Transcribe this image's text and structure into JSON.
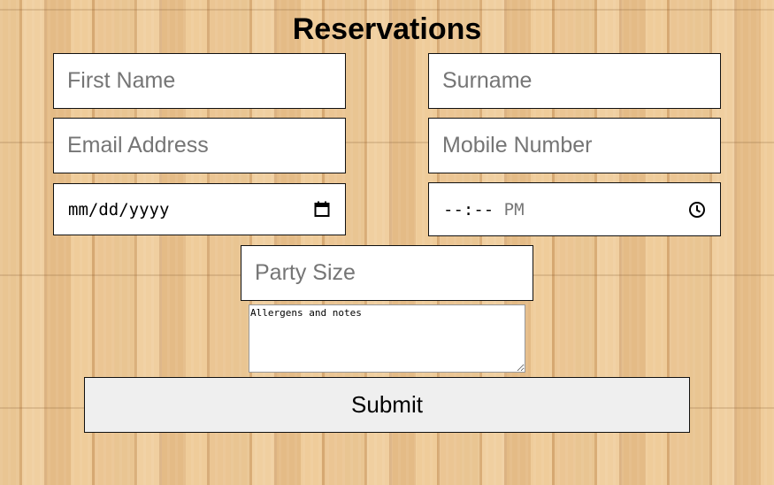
{
  "page": {
    "title": "Reservations"
  },
  "form": {
    "first_name": {
      "placeholder": "First Name",
      "value": ""
    },
    "surname": {
      "placeholder": "Surname",
      "value": ""
    },
    "email": {
      "placeholder": "Email Address",
      "value": ""
    },
    "mobile": {
      "placeholder": "Mobile Number",
      "value": ""
    },
    "date": {
      "display": "mm/dd/yyyy",
      "icon": "calendar-icon"
    },
    "time": {
      "display_hm": "--:--",
      "display_ampm": "PM",
      "icon": "clock-icon"
    },
    "party_size": {
      "placeholder": "Party Size",
      "value": ""
    },
    "notes": {
      "placeholder": "Allergens and notes",
      "value": ""
    },
    "submit_label": "Submit"
  },
  "colors": {
    "background": "#e6c08f",
    "field_background": "#ffffff",
    "button_background": "#efefef",
    "border": "#111111",
    "placeholder": "#757575"
  }
}
